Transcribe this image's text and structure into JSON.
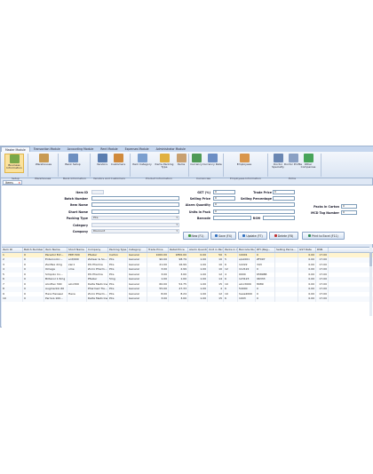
{
  "menu": [
    "Master Module",
    "Transaction Module",
    "Accounting Module",
    "Rent Module",
    "Expenses Module",
    "Administrator Module"
  ],
  "ribbon": {
    "buttons": [
      "Business Information",
      "Warehouses",
      "Bank Setup",
      "Vendors",
      "Customers",
      "Item Category",
      "Items Packing Type",
      "Items",
      "Currency",
      "Currency Rate",
      "Employees",
      "Doctor Specialty",
      "Doctor Profile",
      "Other Companies"
    ],
    "groups": [
      "Setup",
      "Warehouses",
      "Bank Information",
      "Vendors and Customers",
      "Product Information",
      "Currencies",
      "Employees Information",
      "Extra"
    ]
  },
  "doc_tab": {
    "label": "Items",
    "close": "×"
  },
  "form": {
    "labels": {
      "item_id": "Item ID",
      "batch": "Batch Number",
      "item_name": "Item Name",
      "short_name": "Short Name",
      "packing_type": "Packing Type",
      "category": "Category",
      "company": "Company",
      "gst": "GST (%)",
      "selling_price": "Selling Price",
      "alarm_qty": "Alarm Quantity",
      "units_pack": "Units in Pack",
      "barcode": "Barcode",
      "trade_price": "Trade Price",
      "selling_pct": "Selling Percentage",
      "rsm": "RSM",
      "packs_carton": "Packs in Carton",
      "mcd": "MCD Tag Number"
    },
    "values": {
      "item_id": "",
      "packing_type": "PCs",
      "category": "",
      "company": "Discount",
      "gst": "0",
      "selling_price": "0",
      "alarm_qty": "0",
      "units_pack": "0",
      "trade_price": "0",
      "packs_carton": "0",
      "mcd": "0"
    },
    "required_marker": "*"
  },
  "actions": [
    "New (F1)",
    "Save (F4)",
    "Update (F7)",
    "Delete (F8)",
    "Print to Excel (F11)"
  ],
  "grid": {
    "columns": [
      "Item ID",
      "Batch Number",
      "Item Name",
      "Short Name",
      "Company",
      "Packing Type",
      "Category",
      "Trade Price",
      "Retail Price",
      "Alarm Quanti...",
      "Unit in Pack",
      "Packs in Car...",
      "Barcode Nu...",
      "RFI (Reg...",
      "Selling Perce...",
      "GST Rate",
      "RSN"
    ],
    "rows": [
      [
        "1",
        "0",
        "Panadol Ext...",
        "PDE-500",
        "Pfeizer",
        "Carton",
        "General",
        "1000.00",
        "1850.00",
        "0.00",
        "50",
        "5",
        "10001",
        "0",
        "",
        "0.00",
        "17.00"
      ],
      [
        "2",
        "0",
        "Enterocolic...",
        "ent/900",
        "Zaheer & So...",
        "PCs",
        "General",
        "90.00",
        "98.79",
        "1.00",
        "10",
        "5",
        "a/s1001",
        "ZF097",
        "",
        "0.00",
        "17.00"
      ],
      [
        "3",
        "0",
        "Zanflex 2mg",
        "zan1",
        "DS Pharma",
        "PCs",
        "General",
        "21.00",
        "16.99",
        "1.00",
        "10",
        "6",
        "12222",
        "343",
        "",
        "0.00",
        "17.00"
      ],
      [
        "4",
        "0",
        "Omega",
        "ome",
        "Zorro Pharm...",
        "PCs",
        "General",
        "3.00",
        "2.99",
        "1.00",
        "10",
        "12",
        "112122",
        "0",
        "",
        "0.00",
        "17.00"
      ],
      [
        "5",
        "0",
        "Simpolo Co...",
        "",
        "DS Pharma",
        "PCs",
        "General",
        "3.00",
        "3.00",
        "1.00",
        "12",
        "4",
        "0000",
        "658988",
        "",
        "0.00",
        "17.00"
      ],
      [
        "6",
        "0",
        "Britanol 1.5mg",
        "",
        "Pfeizer",
        "5mg",
        "General",
        "1.00",
        "1.00",
        "1.00",
        "14",
        "6",
        "123123",
        "96333",
        "",
        "0.00",
        "17.00"
      ],
      [
        "7",
        "0",
        "Alcoflex 300",
        "alco300",
        "Delta Medicine",
        "PCs",
        "General",
        "60.00",
        "52.75",
        "1.00",
        "15",
        "10",
        "alco3009",
        "8989",
        "",
        "0.00",
        "17.00"
      ],
      [
        "8",
        "0",
        "Augmentin 60",
        "",
        "Pharmed Tra...",
        "PCs",
        "General",
        "55.00",
        "47.33",
        "1.00",
        "4",
        "6",
        "54000",
        "0",
        "",
        "0.00",
        "17.00"
      ],
      [
        "9",
        "0",
        "Hara Hexasul",
        "Hexa",
        "Zorro Pharm...",
        "PCs",
        "General",
        "8.00",
        "8.24",
        "1.00",
        "12",
        "10",
        "hexa4000",
        "0",
        "",
        "0.00",
        "17.00"
      ],
      [
        "10",
        "0",
        "Perriva 100...",
        "",
        "Delta Medicine",
        "PCs",
        "General",
        "3.00",
        "3.00",
        "1.00",
        "15",
        "6",
        "1003",
        "0",
        "",
        "0.00",
        "17.00"
      ]
    ]
  },
  "colors": {
    "ribbon_selected": "#fbe29c",
    "new": "#3c9a3c",
    "save": "#2f6fbf",
    "update": "#2f6fbf",
    "delete": "#c03030",
    "excel": "#2e8b57"
  }
}
